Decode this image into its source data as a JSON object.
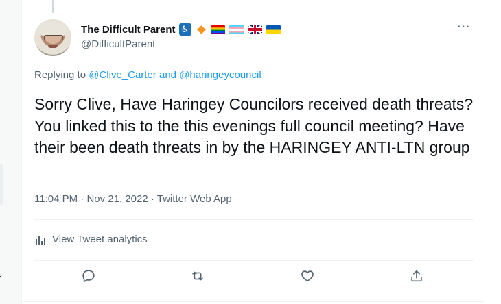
{
  "tweet": {
    "author": {
      "display_name": "The Difficult Parent",
      "handle": "@DifficultParent",
      "badges": [
        "accessibility-icon",
        "orange-diamond-icon",
        "rainbow-flag-icon",
        "transgender-flag-icon",
        "uk-flag-icon",
        "ukraine-flag-icon"
      ]
    },
    "replying_prefix": "Replying to",
    "replying_user1": "@Clive_Carter",
    "replying_and": "and",
    "replying_user2": "@haringeycouncil",
    "text": "Sorry Clive, Have Haringey Councilors received death threats? You linked this to the this evenings full council meeting? Have their been death threats in by the HARINGEY ANTI-LTN group",
    "time": "11:04 PM",
    "date": "Nov 21, 2022",
    "source": "Twitter Web App",
    "meta_sep": "·",
    "analytics_label": "View Tweet analytics",
    "more_label": "···"
  },
  "colors": {
    "text": "#0f1419",
    "secondary": "#536471",
    "link": "#1d9bf0",
    "divider": "#eff3f4"
  }
}
